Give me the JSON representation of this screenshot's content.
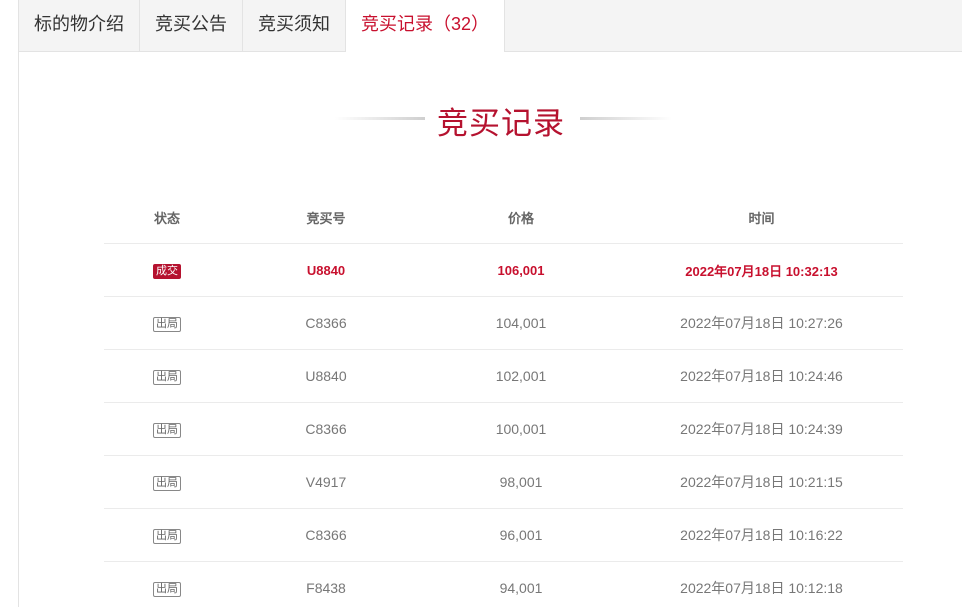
{
  "tabs": [
    {
      "label": "标的物介绍",
      "active": false
    },
    {
      "label": "竞买公告",
      "active": false
    },
    {
      "label": "竞买须知",
      "active": false
    },
    {
      "label": "竞买记录（32）",
      "active": true
    }
  ],
  "section_title": "竞买记录",
  "table": {
    "headers": {
      "status": "状态",
      "bidder": "竞买号",
      "price": "价格",
      "time": "时间"
    },
    "rows": [
      {
        "status": "成交",
        "bidder": "U8840",
        "price": "106,001",
        "time": "2022年07月18日 10:32:13",
        "won": true
      },
      {
        "status": "出局",
        "bidder": "C8366",
        "price": "104,001",
        "time": "2022年07月18日 10:27:26",
        "won": false
      },
      {
        "status": "出局",
        "bidder": "U8840",
        "price": "102,001",
        "time": "2022年07月18日 10:24:46",
        "won": false
      },
      {
        "status": "出局",
        "bidder": "C8366",
        "price": "100,001",
        "time": "2022年07月18日 10:24:39",
        "won": false
      },
      {
        "status": "出局",
        "bidder": "V4917",
        "price": "98,001",
        "time": "2022年07月18日 10:21:15",
        "won": false
      },
      {
        "status": "出局",
        "bidder": "C8366",
        "price": "96,001",
        "time": "2022年07月18日 10:16:22",
        "won": false
      },
      {
        "status": "出局",
        "bidder": "F8438",
        "price": "94,001",
        "time": "2022年07月18日 10:12:18",
        "won": false
      }
    ]
  },
  "colors": {
    "accent": "#c8102e",
    "badge_won": "#b5122f"
  }
}
